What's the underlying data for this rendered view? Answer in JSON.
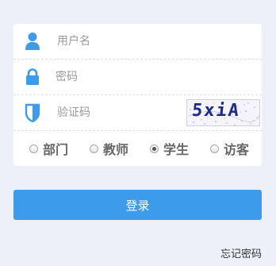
{
  "form": {
    "username_placeholder": "用户名",
    "password_placeholder": "密码",
    "captcha_placeholder": "验证码",
    "captcha_image_text": "5xiA"
  },
  "icons": {
    "user": "user-icon",
    "lock": "lock-icon",
    "shield": "shield-icon"
  },
  "roles": [
    {
      "label": "部门",
      "checked": false
    },
    {
      "label": "教师",
      "checked": false
    },
    {
      "label": "学生",
      "checked": true
    },
    {
      "label": "访客",
      "checked": false
    }
  ],
  "login_label": "登录",
  "forgot_label": "忘记密码",
  "colors": {
    "accent": "#3c9bea",
    "background": "#eef0f9",
    "icon": "#3c9bea"
  }
}
